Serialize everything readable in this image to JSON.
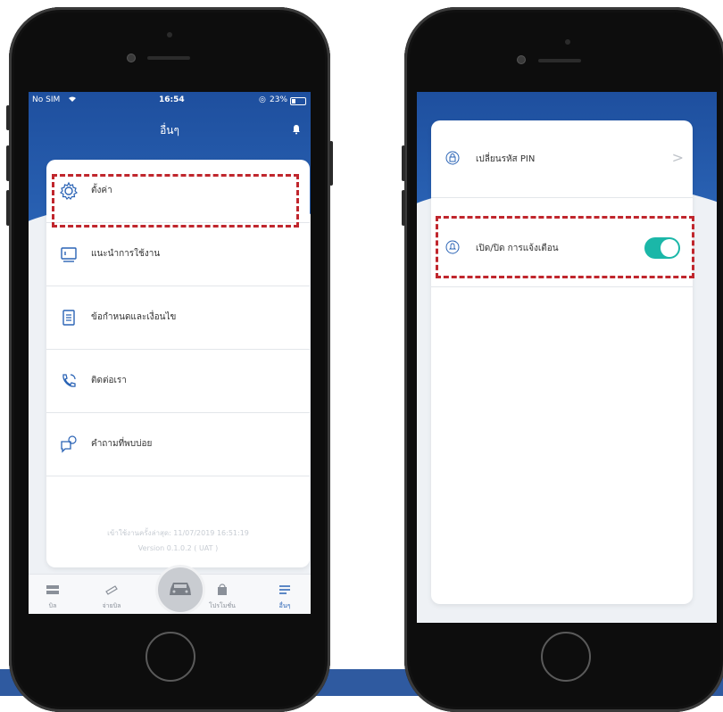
{
  "left_phone": {
    "status": {
      "carrier": "No SIM",
      "time": "16:54",
      "battery": "23%"
    },
    "header_title": "อื่นๆ",
    "menu": [
      {
        "label": "ตั้งค่า",
        "icon": "gear-icon"
      },
      {
        "label": "แนะนำการใช้งาน",
        "icon": "book-icon"
      },
      {
        "label": "ข้อกำหนดและเงื่อนไข",
        "icon": "document-icon"
      },
      {
        "label": "ติดต่อเรา",
        "icon": "phone-icon"
      },
      {
        "label": "คำถามที่พบบ่อย",
        "icon": "faq-icon"
      }
    ],
    "last_login": "เข้าใช้งานครั้งล่าสุด: 11/07/2019 16:51:19",
    "version": "Version 0.1.0.2 ( UAT )",
    "tabs": [
      {
        "label": "บิล",
        "icon": "bill-icon"
      },
      {
        "label": "จ่ายบิล",
        "icon": "card-icon"
      },
      {
        "label": "",
        "icon": "car-icon"
      },
      {
        "label": "โปรโมชั่น",
        "icon": "bag-icon"
      },
      {
        "label": "อื่นๆ",
        "icon": "menu-icon"
      }
    ]
  },
  "right_phone": {
    "settings": [
      {
        "label": "เปลี่ยนรหัส PIN",
        "icon": "lock-icon",
        "control": "chevron"
      },
      {
        "label": "เปิด/ปิด การแจ้งเตือน",
        "icon": "bell-icon",
        "control": "toggle",
        "enabled": true
      }
    ]
  },
  "colors": {
    "header": "#1e4f9e",
    "toggle_on": "#1bb7a8",
    "highlight_dash": "#c0262d",
    "active_tab": "#2a63b5"
  }
}
